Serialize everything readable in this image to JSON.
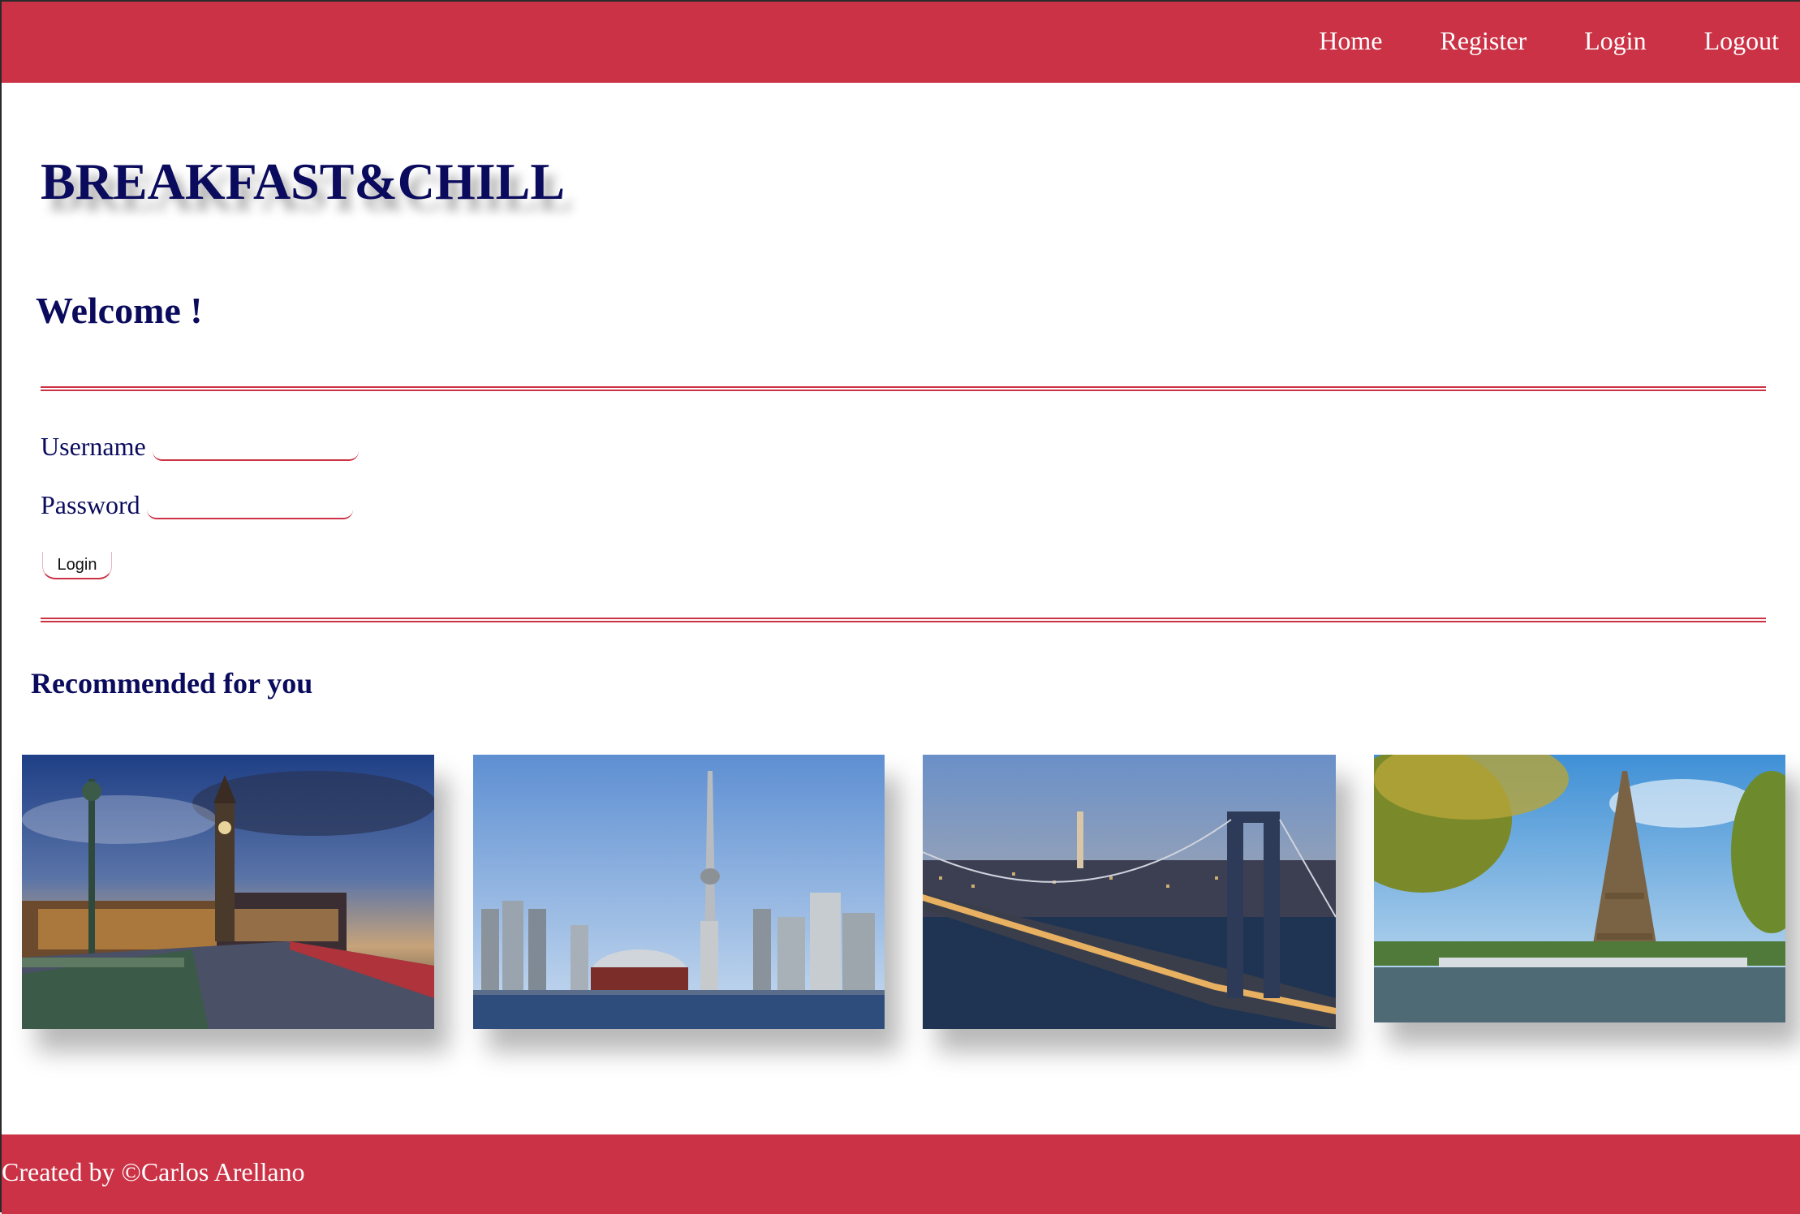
{
  "nav": {
    "items": [
      {
        "label": "Home"
      },
      {
        "label": "Register"
      },
      {
        "label": "Login"
      },
      {
        "label": "Logout"
      }
    ]
  },
  "header": {
    "brand": "BREAKFAST&CHILL",
    "welcome": "Welcome !"
  },
  "login_form": {
    "username_label": "Username",
    "username_value": "",
    "password_label": "Password",
    "password_value": "",
    "submit_label": "Login"
  },
  "recommended": {
    "title": "Recommended for you",
    "cards": [
      {
        "icon": "london-big-ben-photo"
      },
      {
        "icon": "toronto-cn-tower-photo"
      },
      {
        "icon": "new-york-manhattan-bridge-photo"
      },
      {
        "icon": "paris-eiffel-tower-photo"
      }
    ]
  },
  "footer": {
    "text": "Created by ©Carlos Arellano"
  },
  "colors": {
    "brand_red": "#cc3245",
    "heading_navy": "#0b0b5e"
  }
}
